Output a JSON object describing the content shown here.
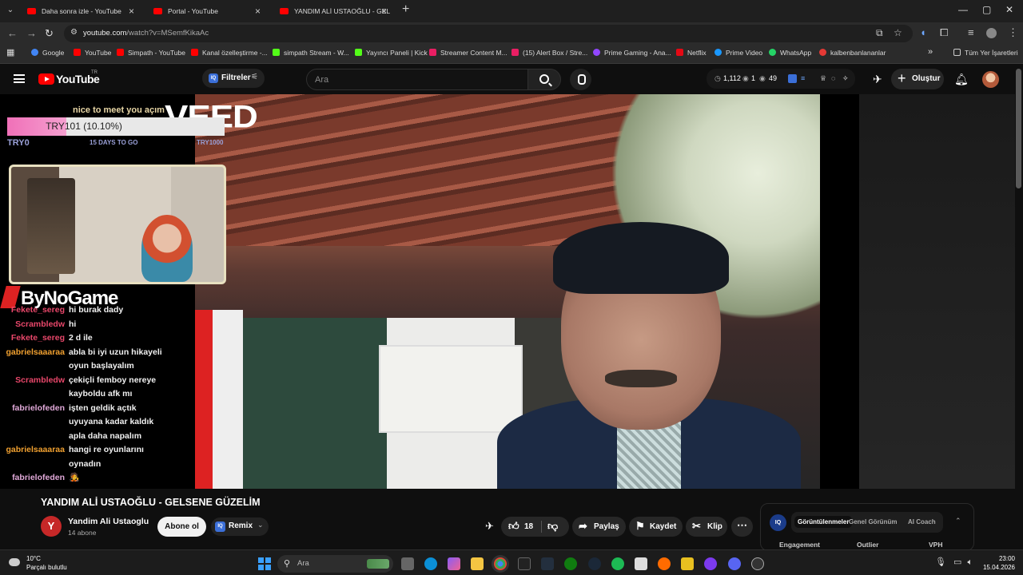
{
  "browser": {
    "tabs": [
      {
        "label": "Daha sonra izle - YouTube",
        "active": false
      },
      {
        "label": "Portal - YouTube",
        "active": false
      },
      {
        "label": "YANDIM ALİ USTAOĞLU - GELS",
        "active": true
      }
    ],
    "url_host": "youtube.com",
    "url_path": "/watch?v=MSemfKikaAc",
    "bookmarks": [
      {
        "label": "Google",
        "color": "#4285f4"
      },
      {
        "label": "YouTube",
        "color": "#ff0000"
      },
      {
        "label": "Simpath - YouTube",
        "color": "#ff0000"
      },
      {
        "label": "Kanal özelleştirme -...",
        "color": "#ff0000"
      },
      {
        "label": "simpath Stream - W...",
        "color": "#53fc18"
      },
      {
        "label": "Yayıncı Paneli | Kick",
        "color": "#53fc18"
      },
      {
        "label": "Streamer Content M...",
        "color": "#e91e63"
      },
      {
        "label": "(15) Alert Box / Stre...",
        "color": "#e91e63"
      },
      {
        "label": "Prime Gaming - Ana...",
        "color": "#9146ff"
      },
      {
        "label": "Netflix",
        "color": "#e50914"
      },
      {
        "label": "Prime Video",
        "color": "#1a98ff"
      },
      {
        "label": "WhatsApp",
        "color": "#25d366"
      },
      {
        "label": "kalbenbanlananlar",
        "color": "#e53935"
      }
    ],
    "all_bookmarks": "Tüm Yer İşaretleri"
  },
  "youtube": {
    "logo_text": "YouTube",
    "country": "TR",
    "filters_label": "Filtreler",
    "search_placeholder": "Ara",
    "stats": {
      "views": "1,112",
      "a": "1",
      "b": "49"
    },
    "create_label": "Oluştur"
  },
  "overlay": {
    "goal_top": "nice to meet you açım",
    "goal_text": "TRY101 (10.10%)",
    "goal_progress": 0.101,
    "goal_min": "TRY0",
    "goal_days": "15 DAYS TO GO",
    "goal_max": "TRY1000",
    "watermark": "VEED",
    "brand": "ByNoGame"
  },
  "chat": [
    {
      "user": "Fekete_sereg",
      "color": "#e8476a",
      "text": "hi burak dady"
    },
    {
      "user": "Scrambledw",
      "color": "#e8476a",
      "text": "hi"
    },
    {
      "user": "Fekete_sereg",
      "color": "#e8476a",
      "text": "2 d ile"
    },
    {
      "user": "gabrielsaaaraa",
      "color": "#f0a030",
      "text": "abla bi iyi uzun hikayeli oyun başlayalım"
    },
    {
      "user": "Scrambledw",
      "color": "#e8476a",
      "text": "çekiçli femboy nereye kayboldu afk mı"
    },
    {
      "user": "fabrielofeden",
      "color": "#e0a8d8",
      "text": "işten geldik açtık uyuyana kadar kaldık apla daha napalım"
    },
    {
      "user": "gabrielsaaaraa",
      "color": "#f0a030",
      "text": "hangi re oyunlarını oynadın"
    },
    {
      "user": "fabrielofeden",
      "color": "#e0a8d8",
      "text": "🧑‍🎤"
    }
  ],
  "video": {
    "title": "YANDIM ALİ USTAOĞLU - GELSENE GÜZELİM",
    "channel_initial": "Y",
    "channel_name": "Yandim Ali Ustaoglu",
    "subscribers": "14 abone",
    "subscribe_label": "Abone ol",
    "remix_label": "Remix",
    "likes": "18",
    "share_label": "Paylaş",
    "save_label": "Kaydet",
    "clip_label": "Klip"
  },
  "iq_panel": {
    "tabs": [
      "Görüntülenmeler",
      "Genel Görünüm",
      "AI Coach"
    ],
    "columns": [
      "Engagement",
      "Outlier",
      "VPH"
    ]
  },
  "taskbar": {
    "temperature": "10°C",
    "condition": "Parçalı bulutlu",
    "search_label": "Ara",
    "time": "23:00",
    "date": "15.04.2026"
  }
}
